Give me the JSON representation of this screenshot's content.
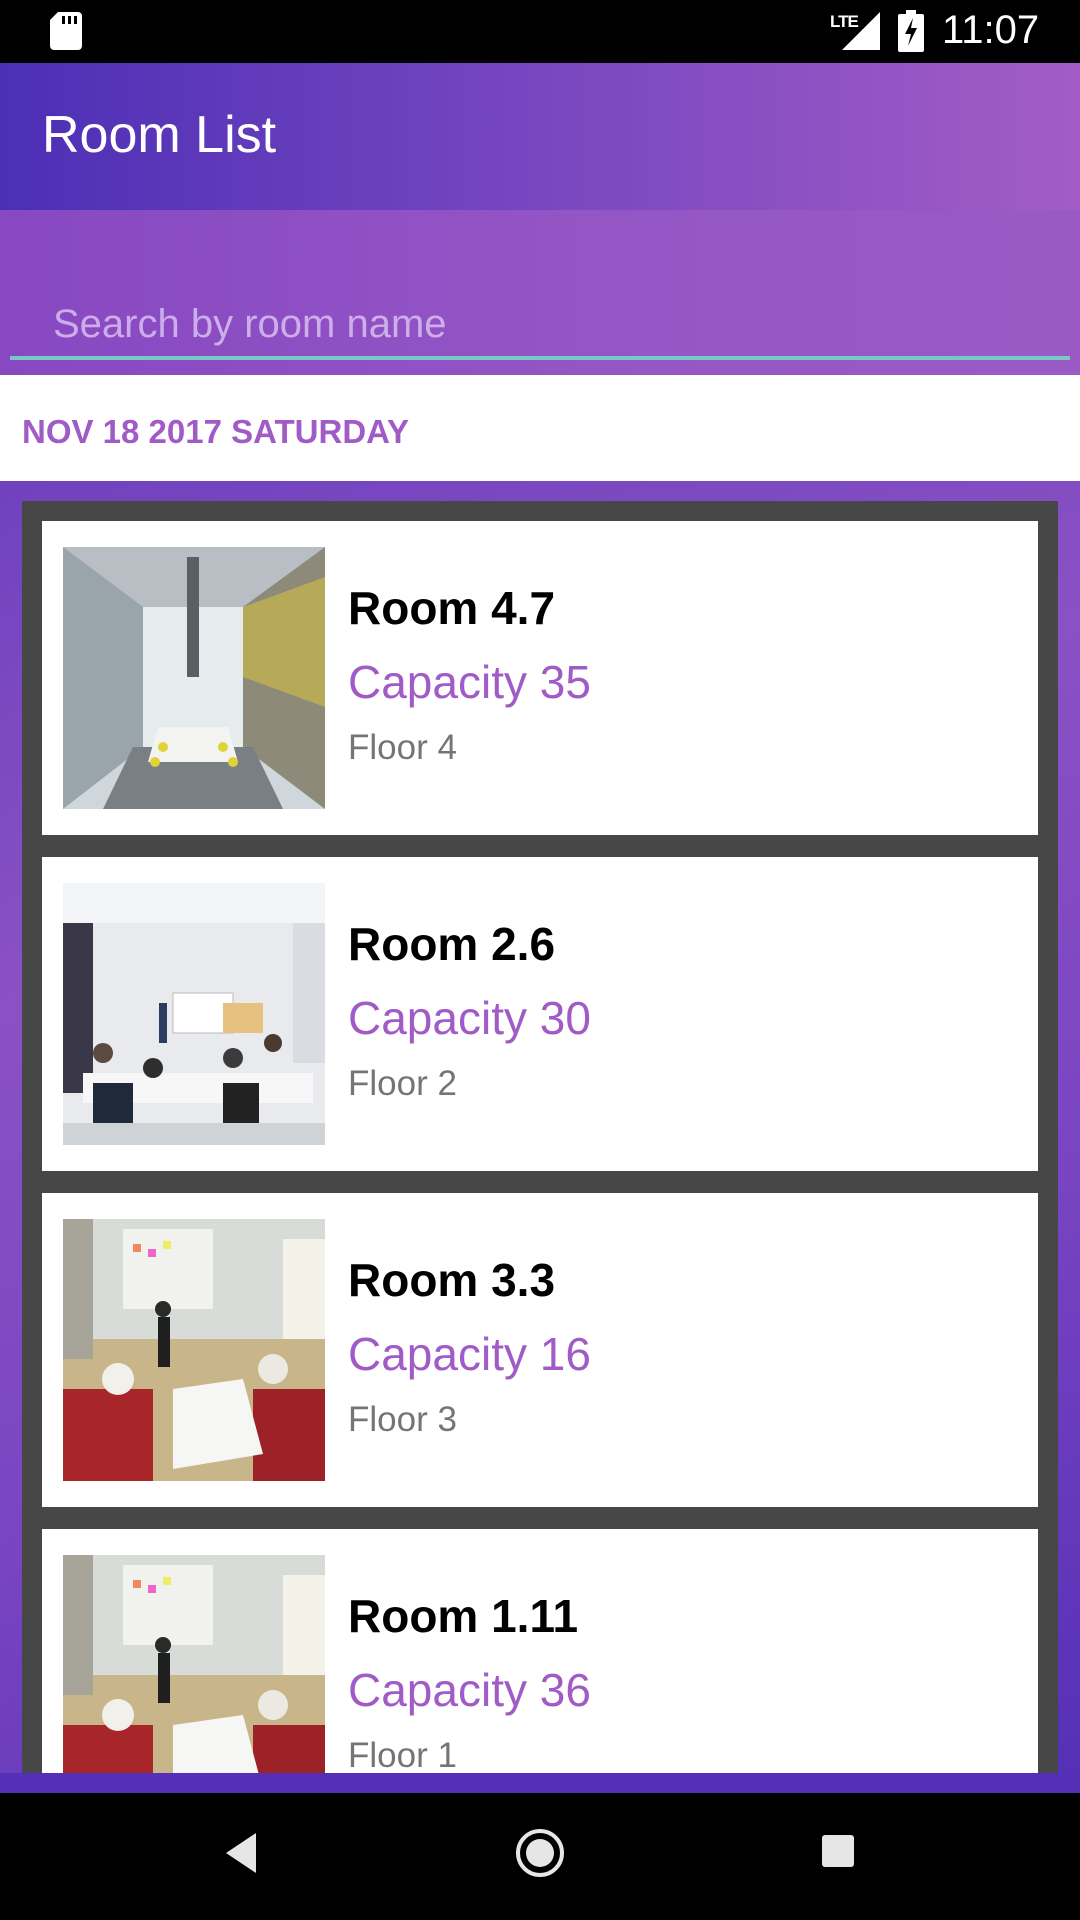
{
  "status_bar": {
    "time": "11:07",
    "network": "LTE",
    "icons": [
      "sd-card-icon",
      "signal-icon",
      "battery-charging-icon"
    ]
  },
  "toolbar": {
    "title": "Room List"
  },
  "search": {
    "placeholder": "Search by room name",
    "value": ""
  },
  "date_header": "NOV 18 2017 SATURDAY",
  "rooms": [
    {
      "name": "Room 4.7",
      "capacity": "Capacity 35",
      "floor": "Floor 4",
      "image": "conference-room-photo"
    },
    {
      "name": "Room 2.6",
      "capacity": "Capacity 30",
      "floor": "Floor 2",
      "image": "classroom-photo"
    },
    {
      "name": "Room 3.3",
      "capacity": "Capacity 16",
      "floor": "Floor 3",
      "image": "lounge-meeting-photo"
    },
    {
      "name": "Room 1.11",
      "capacity": "Capacity 36",
      "floor": "Floor 1",
      "image": "lounge-meeting-photo"
    }
  ],
  "nav_bar": {
    "icons": [
      "back-icon",
      "home-icon",
      "recents-icon"
    ]
  },
  "colors": {
    "accent": "#a15bc6",
    "toolbar_start": "#4c2fb5",
    "toolbar_end": "#a35cc6",
    "search_underline": "#79c8c8",
    "card_border": "#474747"
  }
}
